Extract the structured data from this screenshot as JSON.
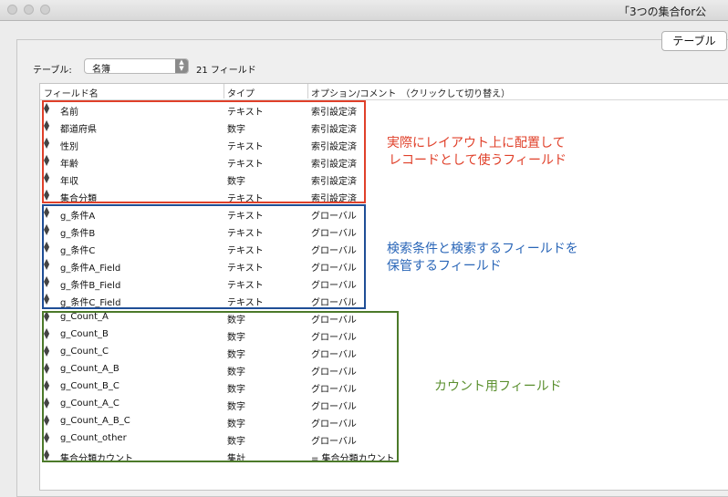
{
  "window": {
    "title": "「3つの集合for公"
  },
  "toolbar": {
    "table_button": "テーブル"
  },
  "table_selector": {
    "label": "テーブル:",
    "selected": "名簿",
    "field_count": "21 フィールド"
  },
  "columns": {
    "field_name": "フィールド名",
    "type": "タイプ",
    "options": "オプション/コメント　（クリックして切り替え）"
  },
  "rows": [
    {
      "name": "名前",
      "type": "テキスト",
      "option": "索引設定済"
    },
    {
      "name": "都道府県",
      "type": "数字",
      "option": "索引設定済"
    },
    {
      "name": "性別",
      "type": "テキスト",
      "option": "索引設定済"
    },
    {
      "name": "年齢",
      "type": "テキスト",
      "option": "索引設定済"
    },
    {
      "name": "年収",
      "type": "数字",
      "option": "索引設定済"
    },
    {
      "name": "集合分類",
      "type": "テキスト",
      "option": "索引設定済"
    },
    {
      "name": "g_条件A",
      "type": "テキスト",
      "option": "グローバル"
    },
    {
      "name": "g_条件B",
      "type": "テキスト",
      "option": "グローバル"
    },
    {
      "name": "g_条件C",
      "type": "テキスト",
      "option": "グローバル"
    },
    {
      "name": "g_条件A_Field",
      "type": "テキスト",
      "option": "グローバル"
    },
    {
      "name": "g_条件B_Field",
      "type": "テキスト",
      "option": "グローバル"
    },
    {
      "name": "g_条件C_Field",
      "type": "テキスト",
      "option": "グローバル"
    },
    {
      "name": "g_Count_A",
      "type": "数字",
      "option": "グローバル"
    },
    {
      "name": "g_Count_B",
      "type": "数字",
      "option": "グローバル"
    },
    {
      "name": "g_Count_C",
      "type": "数字",
      "option": "グローバル"
    },
    {
      "name": "g_Count_A_B",
      "type": "数字",
      "option": "グローバル"
    },
    {
      "name": "g_Count_B_C",
      "type": "数字",
      "option": "グローバル"
    },
    {
      "name": "g_Count_A_C",
      "type": "数字",
      "option": "グローバル"
    },
    {
      "name": "g_Count_A_B_C",
      "type": "数字",
      "option": "グローバル"
    },
    {
      "name": "g_Count_other",
      "type": "数字",
      "option": "グローバル"
    },
    {
      "name": "集合分類カウント",
      "type": "集計",
      "option": "= 集合分類カウント"
    }
  ],
  "annotations": {
    "red_line1": "実際にレイアウト上に配置して",
    "red_line2": "レコードとして使うフィールド",
    "blue_line1": "検索条件と検索するフィールドを",
    "blue_line2": "保管するフィールド",
    "green": "カウント用フィールド"
  },
  "colors": {
    "red": "#e0402a",
    "blue": "#1f4e96",
    "green": "#4c7a2a"
  },
  "icons": {
    "drag_handle": "drag-handle-icon",
    "select_arrows": "up-down-arrows-icon"
  }
}
